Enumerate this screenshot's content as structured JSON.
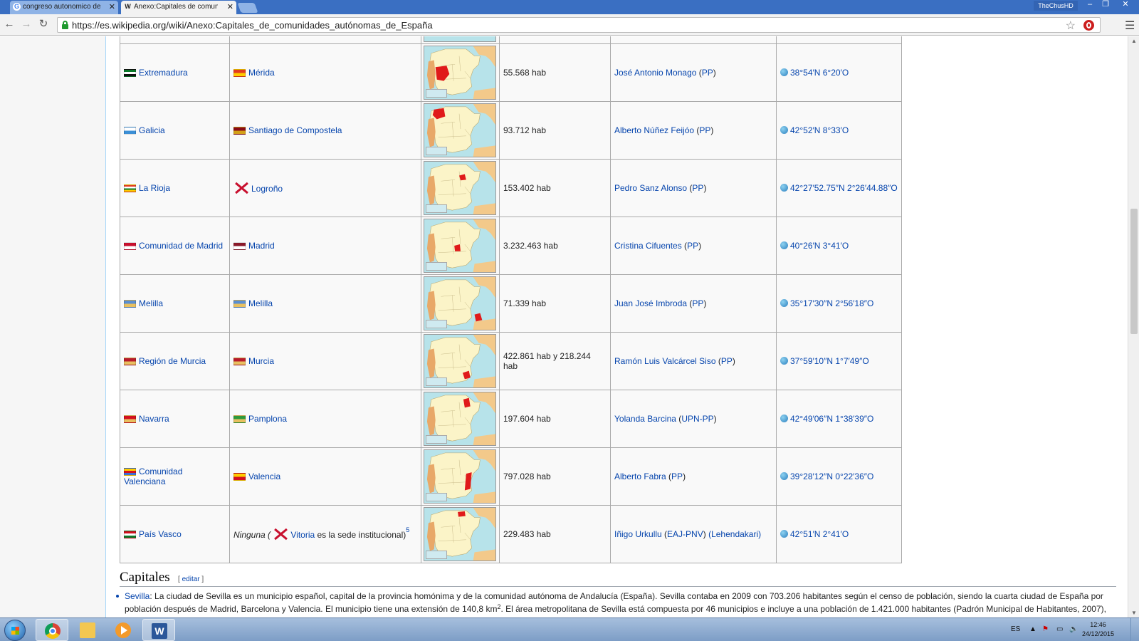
{
  "browser": {
    "tabs": [
      {
        "title": "congreso autonomico de",
        "icon": "G",
        "active": false
      },
      {
        "title": "Anexo:Capitales de comun",
        "icon": "W",
        "active": true
      }
    ],
    "user": "TheChusHD",
    "url": "https://es.wikipedia.org/wiki/Anexo:Capitales_de_comunidades_autónomas_de_España"
  },
  "table": {
    "rows": [
      {
        "community": "Extremadura",
        "capital": "Mérida",
        "population": "55.568 hab",
        "president": "José Antonio Monago",
        "party": "PP",
        "coords": "38°54′N 6°20′O",
        "flag1": [
          "#0a7a2a",
          "#ffffff",
          "#111111"
        ],
        "flag2": [
          "#e33b1e",
          "#ffcc00"
        ],
        "hl": "extremadura"
      },
      {
        "community": "Galicia",
        "capital": "Santiago de Compostela",
        "population": "93.712 hab",
        "president": "Alberto Núñez Feijóo",
        "party": "PP",
        "coords": "42°52′N 8°33′O",
        "flag1": [
          "#ffffff",
          "#3b8fd6"
        ],
        "flag2": [
          "#8a0a14",
          "#d4a017"
        ],
        "hl": "galicia"
      },
      {
        "community": "La Rioja",
        "capital": "Logroño",
        "population": "153.402 hab",
        "president": "Pedro Sanz Alonso",
        "party": "PP",
        "coords": "42°27′52.75″N 2°26′44.88″O",
        "flag1": [
          "#e33b1e",
          "#ffffff",
          "#0a7a2a",
          "#ffcc00"
        ],
        "flag2": [],
        "hl": "rioja"
      },
      {
        "community": "Comunidad de Madrid",
        "capital": "Madrid",
        "population": "3.232.463 hab",
        "president": "Cristina Cifuentes",
        "party": "PP",
        "coords": "40°26′N 3°41′O",
        "flag1": [
          "#c8102e",
          "#ffffff"
        ],
        "flag2": [
          "#8a1a2a",
          "#ffffff"
        ],
        "hl": "madrid"
      },
      {
        "community": "Melilla",
        "capital": "Melilla",
        "population": "71.339 hab",
        "president": "Juan José Imbroda",
        "party": "PP",
        "coords": "35°17′30″N 2°56′18″O",
        "flag1": [
          "#5b8fd0",
          "#e8c060"
        ],
        "flag2": [
          "#5b8fd0",
          "#e8c060"
        ],
        "hl": "melilla"
      },
      {
        "community": "Región de Murcia",
        "capital": "Murcia",
        "population": "422.861 hab y 218.244 hab",
        "president": "Ramón Luis Valcárcel Siso",
        "party": "PP",
        "coords": "37°59′10″N 1°7′49″O",
        "flag1": [
          "#b81a2a",
          "#e8c060"
        ],
        "flag2": [
          "#b81a2a",
          "#e8c060"
        ],
        "hl": "murcia"
      },
      {
        "community": "Navarra",
        "capital": "Pamplona",
        "population": "197.604 hab",
        "president": "Yolanda Barcina",
        "party": "UPN-PP",
        "coords": "42°49′06″N 1°38′39″O",
        "flag1": [
          "#d4101e",
          "#e8c060"
        ],
        "flag2": [
          "#2f9a3a",
          "#e8c060"
        ],
        "hl": "navarra"
      },
      {
        "community": "Comunidad Valenciana",
        "capital": "Valencia",
        "population": "797.028 hab",
        "president": "Alberto Fabra",
        "party": "PP",
        "coords": "39°28′12″N 0°22′36″O",
        "flag1": [
          "#ffcc00",
          "#d4101e",
          "#3b6fd6"
        ],
        "flag2": [
          "#ffcc00",
          "#d4101e"
        ],
        "hl": "valencia"
      },
      {
        "community": "País Vasco",
        "capital_prefix": "Ninguna (",
        "capital": "Vitoria",
        "capital_suffix": " es la sede institucional)",
        "footnote": "5",
        "population": "229.483 hab",
        "president": "Iñigo Urkullu",
        "party": "EAJ-PNV",
        "president_suffix": "(Lehendakari)",
        "coords": "42°51′N 2°41′O",
        "flag1": [
          "#d4101e",
          "#ffffff",
          "#0a7a2a"
        ],
        "flag2": [],
        "hl": "vasco"
      }
    ]
  },
  "section": {
    "title": "Capitales",
    "edit": "editar",
    "paragraph_link": "Sevilla",
    "paragraph_1": ": La ciudad de Sevilla es un municipio español, capital de la provincia homónima y de la comunidad autónoma de Andalucía (España). Sevilla contaba en 2009 con 703.206 habitantes según el censo de población, siendo la cuarta ciudad de España por",
    "paragraph_2": "población después de Madrid, Barcelona y Valencia. El municipio tiene una extensión de 140,8 km",
    "paragraph_sup": "2",
    "paragraph_3": ". El área metropolitana de Sevilla está compuesta por 46 municipios e incluye a una población de 1.421.000 habitantes (Padrón Municipal de Habitantes, 2007),"
  },
  "taskbar": {
    "lang": "ES",
    "time": "12:46",
    "date": "24/12/2015"
  }
}
